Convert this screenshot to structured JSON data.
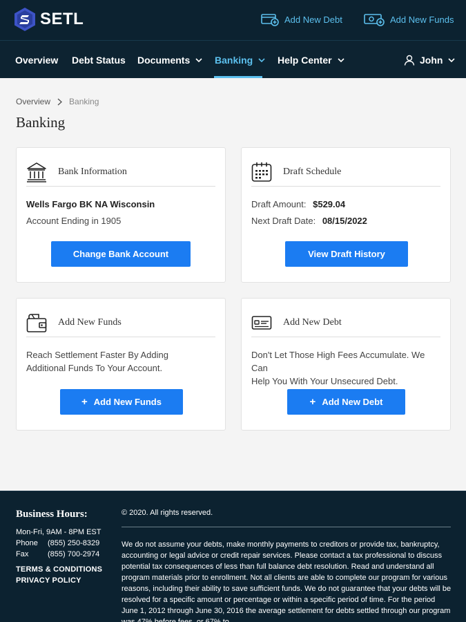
{
  "brand": {
    "name": "SETL"
  },
  "top_actions": {
    "add_debt": "Add New Debt",
    "add_funds": "Add New Funds"
  },
  "nav": {
    "items": [
      "Overview",
      "Debt Status",
      "Documents",
      "Banking",
      "Help Center"
    ],
    "active": "Banking",
    "user": "John"
  },
  "breadcrumb": {
    "home": "Overview",
    "current": "Banking"
  },
  "page_title": "Banking",
  "cards": {
    "bank": {
      "title": "Bank Information",
      "bank_name": "Wells Fargo BK NA Wisconsin",
      "account": "Account Ending in 1905",
      "button": "Change Bank Account"
    },
    "draft": {
      "title": "Draft Schedule",
      "amount_label": "Draft Amount:",
      "amount": "$529.04",
      "date_label": "Next Draft Date:",
      "date": "08/15/2022",
      "button": "View Draft History"
    },
    "funds": {
      "title": "Add New Funds",
      "line1": "Reach Settlement Faster By Adding",
      "line2": "Additional Funds To Your Account.",
      "button": "Add New Funds"
    },
    "debt": {
      "title": "Add New Debt",
      "line1": "Don't Let Those High Fees Accumulate. We Can",
      "line2": "Help You With Your Unsecured Debt.",
      "button": "Add New Debt"
    }
  },
  "footer": {
    "hours_title": "Business Hours:",
    "hours": "Mon-Fri, 9AM - 8PM EST",
    "phone_label": "Phone",
    "phone": "(855) 250-8329",
    "fax_label": "Fax",
    "fax": "(855) 700-2974",
    "terms": "TERMS & CONDITIONS",
    "privacy": "PRIVACY POLICY",
    "copyright": "© 2020. All rights reserved.",
    "disclaimer": "We do not assume your debts, make monthly payments to creditors or provide tax, bankruptcy, accounting or legal advice or credit repair services. Please contact a tax professional to discuss potential tax consequences of less than full balance debt resolution. Read and understand all program materials prior to enrollment. Not all clients are able to complete our program for various reasons, including their ability to save sufficient funds. We do not guarantee that your debts will be resolved for a specific amount or percentage or within a specific period of time. For the period June 1, 2012 through June 30, 2016 the average settlement for debts settled through our program was 47% before fees, or 67% to"
  },
  "colors": {
    "header_bg": "#0c2230",
    "accent": "#5cc0ee",
    "button": "#1b7cf2",
    "page_bg": "#f4f4f4"
  },
  "icons": {
    "logo": "setl-logo-icon",
    "add_debt": "debt-card-plus-icon",
    "add_funds": "cash-plus-icon",
    "bank": "bank-icon",
    "calendar": "calendar-icon",
    "wallet": "wallet-icon",
    "card": "credit-card-icon",
    "user": "user-icon"
  }
}
